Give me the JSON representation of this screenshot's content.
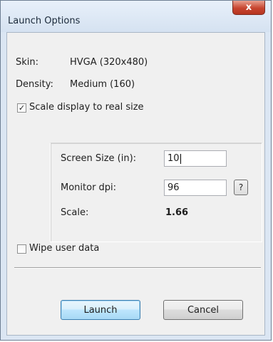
{
  "window": {
    "title": "Launch Options",
    "close_glyph": "x"
  },
  "info": {
    "skin_label": "Skin:",
    "skin_value": "HVGA (320x480)",
    "density_label": "Density:",
    "density_value": "Medium (160)"
  },
  "scale_display": {
    "label": "Scale display to real size",
    "checked": true,
    "check_glyph": "✓"
  },
  "scale_group": {
    "screen_size_label": "Screen Size (in):",
    "screen_size_value": "10",
    "monitor_dpi_label": "Monitor dpi:",
    "monitor_dpi_value": "96",
    "help_label": "?",
    "scale_label": "Scale:",
    "scale_value": "1.66"
  },
  "wipe_user_data": {
    "label": "Wipe user data",
    "checked": false
  },
  "buttons": {
    "launch": "Launch",
    "cancel": "Cancel"
  },
  "colors": {
    "title_bg": "#dbe6f3",
    "close_red": "#c7452f",
    "default_button_border": "#3c7fb1"
  }
}
